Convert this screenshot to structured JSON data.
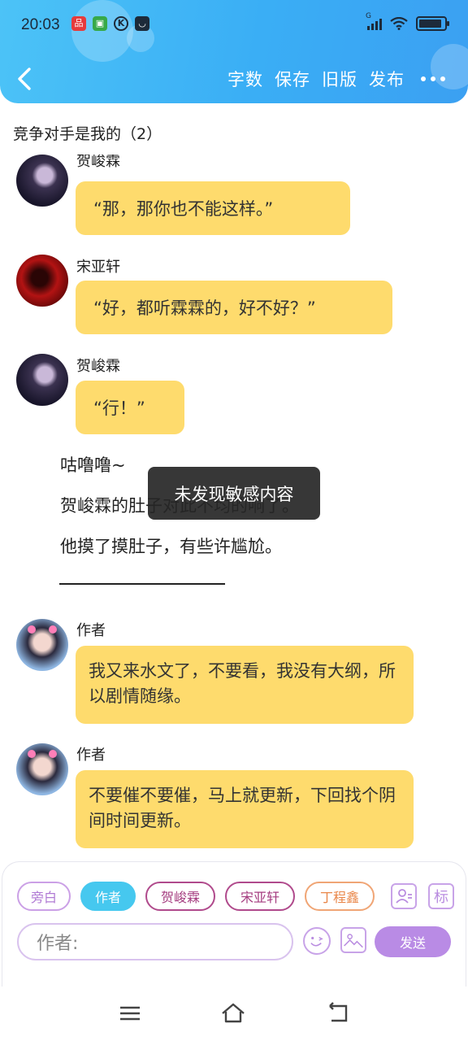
{
  "status_bar": {
    "time": "20:03",
    "network": "G",
    "battery_level": 0.9
  },
  "nav": {
    "actions": [
      "字数",
      "保存",
      "旧版",
      "发布"
    ]
  },
  "chapter_title": "竞争对手是我的（2）",
  "messages": [
    {
      "speaker": "贺峻霖",
      "text": "“那，那你也不能这样。”"
    },
    {
      "speaker": "宋亚轩",
      "text": "“好，都听霖霖的，好不好？”"
    },
    {
      "speaker": "贺峻霖",
      "text": "“行！”"
    }
  ],
  "narration": [
    "咕噜噜~",
    "贺峻霖的肚子对此不均的响了。",
    "他摸了摸肚子，有些许尴尬。"
  ],
  "author_messages": [
    {
      "speaker": "作者",
      "text": "我又来水文了，不要看，我没有大纲，所以剧情随缘。"
    },
    {
      "speaker": "作者",
      "text": "不要催不要催，马上就更新，下回找个阴间时间更新。"
    }
  ],
  "toast": "未发现敏感内容",
  "roles": [
    "旁白",
    "作者",
    "贺峻霖",
    "宋亚轩",
    "丁程鑫"
  ],
  "label_icon": "标",
  "input": {
    "value": "作者:"
  },
  "send_label": "发送",
  "colors": {
    "header": "#3aaef5",
    "bubble": "#fedb6d",
    "send": "#b98be5"
  }
}
